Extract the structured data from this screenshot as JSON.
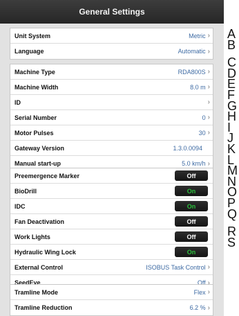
{
  "header": {
    "title": "General Settings"
  },
  "groups": [
    {
      "rows": [
        {
          "label": "Unit System",
          "value": "Metric"
        },
        {
          "label": "Language",
          "value": "Automatic"
        }
      ]
    },
    {
      "rows": [
        {
          "label": "Machine Type",
          "value": "RDA800S"
        },
        {
          "label": "Machine Width",
          "value": "8.0 m"
        },
        {
          "label": "ID",
          "value": ""
        },
        {
          "label": "Serial Number",
          "value": "0"
        },
        {
          "label": "Motor Pulses",
          "value": "30"
        },
        {
          "label": "Gateway Version",
          "value": "1.3.0.0094"
        },
        {
          "label": "Manual start-up",
          "value": "5.0 km/h"
        }
      ]
    },
    {
      "rows": [
        {
          "label": "Preemergence Marker",
          "toggle": "Off"
        },
        {
          "label": "BioDrill",
          "toggle": "On"
        },
        {
          "label": "IDC",
          "toggle": "On"
        },
        {
          "label": "Fan Deactivation",
          "toggle": "Off"
        },
        {
          "label": "Work Lights",
          "toggle": "Off"
        },
        {
          "label": "Hydraulic Wing Lock",
          "toggle": "On"
        },
        {
          "label": "External Control",
          "value": "ISOBUS Task Control"
        },
        {
          "label": "SeedEye",
          "value": "Off"
        }
      ]
    },
    {
      "rows": [
        {
          "label": "Tramline Mode",
          "value": "Flex"
        },
        {
          "label": "Tramline Reduction",
          "value": "6.2 %"
        }
      ]
    }
  ],
  "side_letters": [
    "A",
    "B",
    "C",
    "D",
    "E",
    "F",
    "G",
    "H",
    "I",
    "J",
    "K",
    "L",
    "M",
    "N",
    "O",
    "P",
    "Q",
    "R",
    "S"
  ],
  "colors": {
    "value_text": "#3d6aa3",
    "toggle_on_text": "#2bbf3c",
    "toggle_off_text": "#ffffff"
  }
}
